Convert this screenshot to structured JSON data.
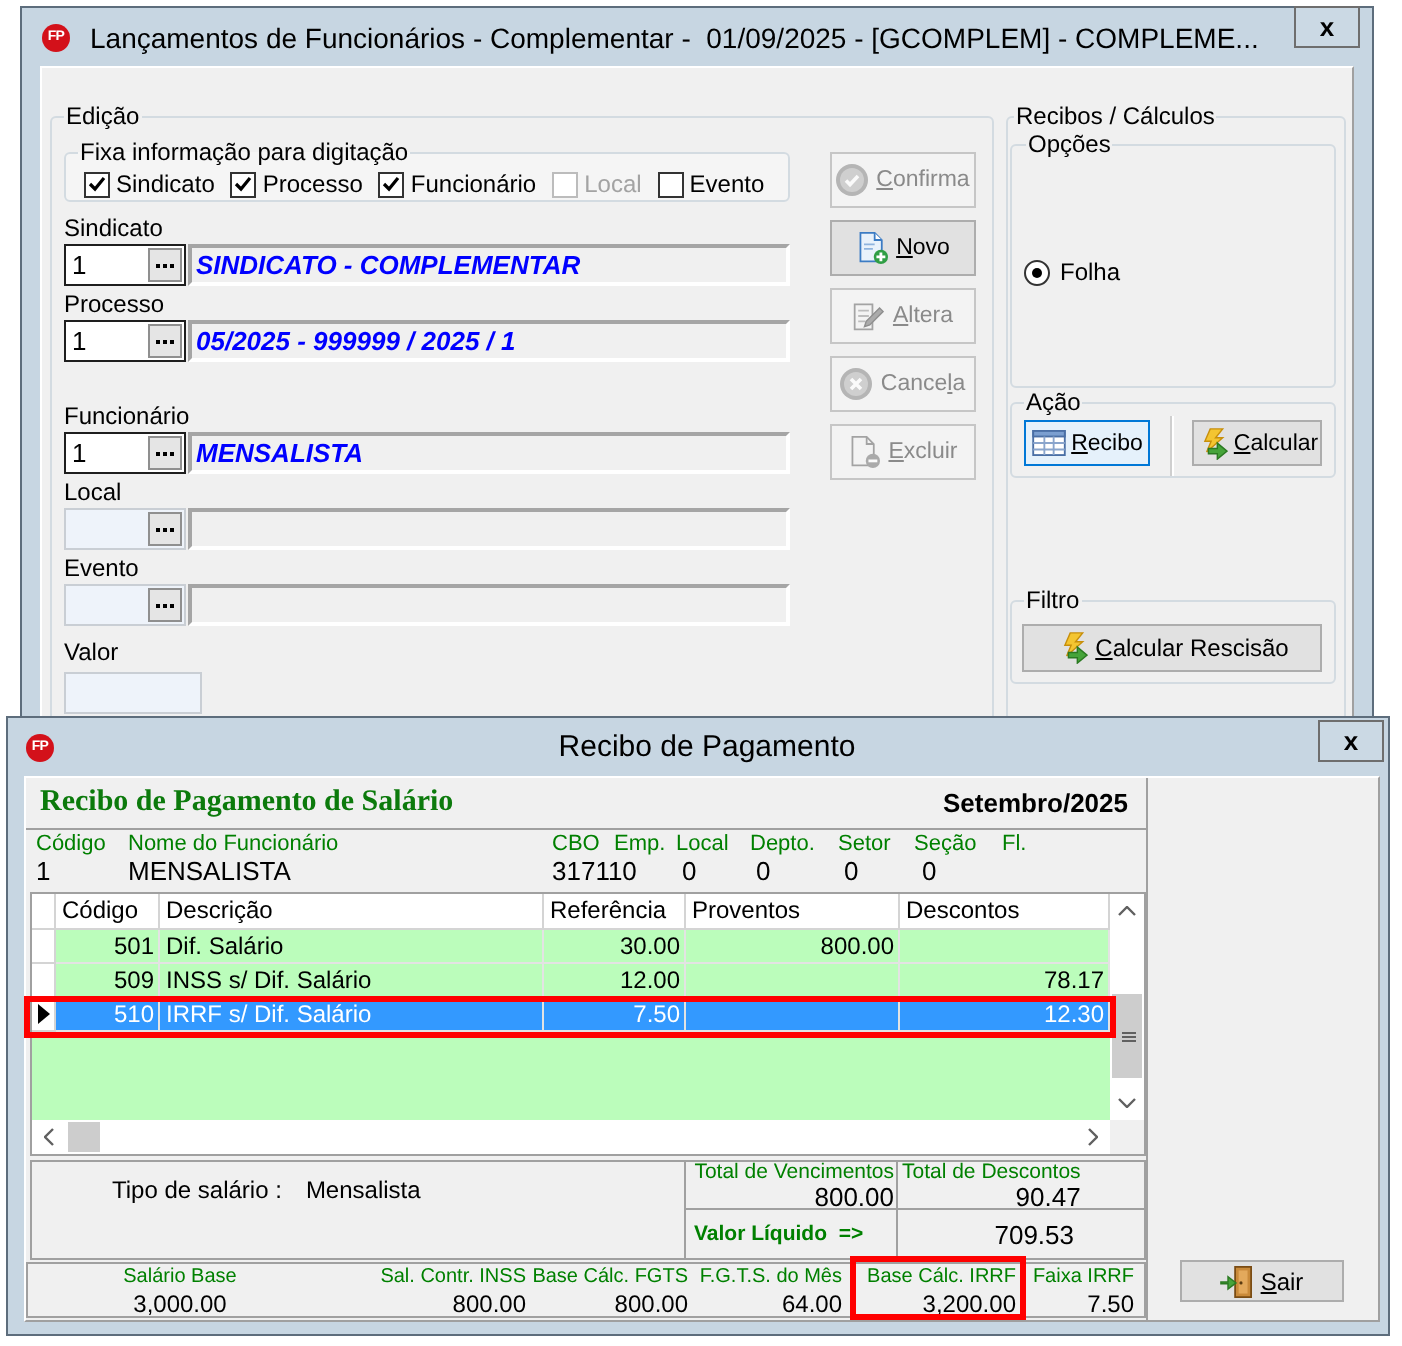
{
  "main_window": {
    "logo": "FP",
    "title": "Lançamentos de Funcionários - Complementar -  01/09/2025 - [GCOMPLEM] - COMPLEME...",
    "close_label": "x",
    "edit_group": {
      "title": "Edição",
      "fix_group": {
        "title": "Fixa informação para digitação",
        "checkboxes": [
          {
            "label": "Sindicato",
            "checked": true,
            "disabled": false
          },
          {
            "label": "Processo",
            "checked": true,
            "disabled": false
          },
          {
            "label": "Funcionário",
            "checked": true,
            "disabled": false
          },
          {
            "label": "Local",
            "checked": false,
            "disabled": true
          },
          {
            "label": "Evento",
            "checked": false,
            "disabled": false
          }
        ]
      },
      "field_groups": [
        {
          "fields": [
            {
              "label": "Sindicato",
              "code": "1",
              "description": "SINDICATO - COMPLEMENTAR"
            },
            {
              "label": "Processo",
              "code": "1",
              "description": "05/2025 - 999999 / 2025 / 1"
            }
          ]
        },
        {
          "fields": [
            {
              "label": "Funcionário",
              "code": "1",
              "description": "MENSALISTA"
            },
            {
              "label": "Local"
            },
            {
              "label": "Evento"
            }
          ]
        }
      ],
      "value_field": {
        "label": "Valor"
      },
      "buttons": [
        {
          "label": "Confirma",
          "disabled": true
        },
        {
          "label": "Novo",
          "disabled": false
        },
        {
          "label": "Altera",
          "disabled": true
        },
        {
          "label": "Cancela",
          "disabled": true
        },
        {
          "label": "Excluir",
          "disabled": true
        }
      ]
    },
    "calc_group": {
      "title": "Recibos / Cálculos",
      "options": {
        "title": "Opções",
        "radios": [
          {
            "label": "Folha",
            "selected": true
          }
        ]
      },
      "action": {
        "title": "Ação",
        "buttons": [
          {
            "label": "Recibo",
            "focused": true
          },
          {
            "label": "Calcular",
            "focused": false
          }
        ]
      },
      "filter": {
        "title": "Filtro",
        "button": {
          "label": "Calcular Rescisão"
        }
      }
    }
  },
  "receipt_window": {
    "logo": "FP",
    "title": "Recibo de Pagamento",
    "close_label": "x",
    "heading": "Recibo de Pagamento de Salário",
    "period": "Setembro/2025",
    "employee_fields": [
      {
        "label": "Código",
        "value": "1"
      },
      {
        "label": "Nome do Funcionário",
        "value": "MENSALISTA"
      },
      {
        "label": "CBO",
        "value": "317110"
      },
      {
        "label": "Emp."
      },
      {
        "label": "Local",
        "value": "0"
      },
      {
        "label": "Depto.",
        "value": "0"
      },
      {
        "label": "Setor",
        "value": "0"
      },
      {
        "label": "Seção",
        "value": "0"
      },
      {
        "label": "Fl."
      }
    ],
    "table": {
      "columns": [
        "Código",
        "Descrição",
        "Referência",
        "Proventos",
        "Descontos"
      ],
      "rows": [
        {
          "code": "501",
          "description": "Dif. Salário",
          "reference": "30.00",
          "earnings": "800.00",
          "selected": false,
          "highlighted": false
        },
        {
          "code": "509",
          "description": "INSS s/ Dif. Salário",
          "reference": "12.00",
          "deductions": "78.17",
          "selected": false,
          "highlighted": false
        },
        {
          "code": "510",
          "description": "IRRF s/ Dif. Salário",
          "reference": "7.50",
          "deductions": "12.30",
          "selected": true,
          "highlighted": true
        }
      ]
    },
    "summary": {
      "salary_type_label": "Tipo de salário :",
      "salary_type": "Mensalista",
      "totals": [
        {
          "label": "Total de Vencimentos",
          "value": "800.00"
        },
        {
          "label": "Total de Descontos",
          "value": "90.47"
        }
      ],
      "net_label": "Valor Líquido  =>",
      "net_value": "709.53"
    },
    "bases": [
      {
        "label": "Salário Base",
        "value": "3,000.00",
        "highlighted": false
      },
      {
        "label": "Sal. Contr. INSS",
        "value": "800.00",
        "highlighted": false
      },
      {
        "label": "Base Cálc. FGTS",
        "value": "800.00",
        "highlighted": false
      },
      {
        "label": "F.G.T.S. do Mês",
        "value": "64.00",
        "highlighted": false
      },
      {
        "label": "Base Cálc. IRRF",
        "value": "3,200.00",
        "highlighted": true
      },
      {
        "label": "Faixa IRRF",
        "value": "7.50",
        "highlighted": false
      }
    ],
    "exit_button": {
      "label": "Sair"
    }
  }
}
